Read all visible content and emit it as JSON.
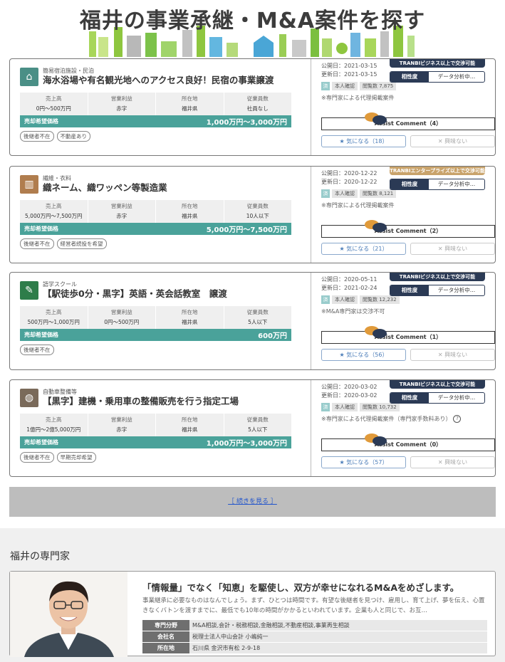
{
  "page_title": "福井の事業承継・M&A案件を探す",
  "listings": [
    {
      "category": "簡易宿泊施設・民泊",
      "category_icon": "building-icon",
      "icon_color": "#4a8f86",
      "title": "海水浴場や有名観光地へのアクセス良好！民宿の事業譲渡",
      "stats": [
        {
          "label": "売上高",
          "value": "0円〜500万円"
        },
        {
          "label": "営業利益",
          "value": "赤字"
        },
        {
          "label": "所在地",
          "value": "福井県"
        },
        {
          "label": "従業員数",
          "value": "社員なし"
        }
      ],
      "price_label": "売却希望価格",
      "price": "1,000万円〜3,000万円",
      "tags": [
        "後継者不在",
        "不動産あり"
      ],
      "published": "公開日：2021-03-15",
      "updated": "更新日：2021-03-15",
      "badge": "TRANBIビジネス以上で交渉可能",
      "badge_gold": false,
      "match_label": "相性度",
      "match_value": "データ分析中…",
      "proc_mark": "済",
      "proc_verified": "本人確認",
      "views": "閲覧数 7,875",
      "note": "※専門家による代理掲載案件",
      "note_help": false,
      "assist": "Assist Comment（4）",
      "fav": "★ 気になる（18）",
      "dislike": "✕ 興味ない"
    },
    {
      "category": "繊維・衣料",
      "category_icon": "factory-icon",
      "icon_color": "#b07d4e",
      "title": "織ネーム、織ワッペン等製造業",
      "stats": [
        {
          "label": "売上高",
          "value": "5,000万円〜7,500万円"
        },
        {
          "label": "営業利益",
          "value": "赤字"
        },
        {
          "label": "所在地",
          "value": "福井県"
        },
        {
          "label": "従業員数",
          "value": "10人以下"
        }
      ],
      "price_label": "売却希望価格",
      "price": "5,000万円〜7,500万円",
      "tags": [
        "後継者不在",
        "経営者続投を希望"
      ],
      "published": "公開日：2020-12-22",
      "updated": "更新日：2020-12-22",
      "badge": "TRANBIエンタープライズ以上で交渉可能",
      "badge_gold": true,
      "match_label": "相性度",
      "match_value": "データ分析中…",
      "proc_mark": "済",
      "proc_verified": "本人確認",
      "views": "閲覧数 8,121",
      "note": "※専門家による代理掲載案件",
      "note_help": false,
      "assist": "Assist Comment（2）",
      "fav": "★ 気になる（21）",
      "dislike": "✕ 興味ない"
    },
    {
      "category": "語学スクール",
      "category_icon": "pencil-icon",
      "icon_color": "#2e7d4a",
      "title": "【駅徒歩0分・黒字】英語・英会話教室　譲渡",
      "stats": [
        {
          "label": "売上高",
          "value": "500万円〜1,000万円"
        },
        {
          "label": "営業利益",
          "value": "0円〜500万円"
        },
        {
          "label": "所在地",
          "value": "福井県"
        },
        {
          "label": "従業員数",
          "value": "5人以下"
        }
      ],
      "price_label": "売却希望価格",
      "price": "600万円",
      "tags": [
        "後継者不在"
      ],
      "published": "公開日：2020-05-11",
      "updated": "更新日：2021-02-24",
      "badge": "TRANBIビジネス以上で交渉可能",
      "badge_gold": false,
      "match_label": "相性度",
      "match_value": "データ分析中…",
      "proc_mark": "済",
      "proc_verified": "本人確認",
      "views": "閲覧数 12,232",
      "note": "※M&A専門家は交渉不可",
      "note_help": false,
      "assist": "Assist Comment（1）",
      "fav": "★ 気になる（56）",
      "dislike": "✕ 興味ない"
    },
    {
      "category": "自動車整備等",
      "category_icon": "globe-icon",
      "icon_color": "#7a6a5a",
      "title": "【黒字】建機・乗用車の整備販売を行う指定工場",
      "stats": [
        {
          "label": "売上高",
          "value": "1億円〜2億5,000万円"
        },
        {
          "label": "営業利益",
          "value": "赤字"
        },
        {
          "label": "所在地",
          "value": "福井県"
        },
        {
          "label": "従業員数",
          "value": "5人以下"
        }
      ],
      "price_label": "売却希望価格",
      "price": "1,000万円〜3,000万円",
      "tags": [
        "後継者不在",
        "早期売却希望"
      ],
      "published": "公開日：2020-03-02",
      "updated": "更新日：2020-03-02",
      "badge": "TRANBIビジネス以上で交渉可能",
      "badge_gold": false,
      "match_label": "相性度",
      "match_value": "データ分析中…",
      "proc_mark": "済",
      "proc_verified": "本人確認",
      "views": "閲覧数 10,732",
      "note": "※専門家による代理掲載案件（専門家手数料あり）",
      "note_help": true,
      "assist": "Assist Comment（0）",
      "fav": "★ 気になる（57）",
      "dislike": "✕ 興味ない"
    }
  ],
  "more_link": "［ 続きを見る ］",
  "experts": {
    "section_title": "福井の専門家",
    "headline": "「情報量」でなく「知恵」を駆使し、双方が幸せになれるM&Aをめざします。",
    "description": "事業継承に必要なものはなんでしょう。まず、ひとつは時間です。有望な後継者を見つけ、雇用し、育て上げ、夢を伝え、心置きなくバトンを渡すまでに、最低でも10年の時間がかかるといわれています。企業も人と同じで、お互…",
    "rows": [
      {
        "key": "専門分野",
        "value": "M&A相談,会計・税務相談,金融相談,不動産相談,事業再生相談"
      },
      {
        "key": "会社名",
        "value": "税理士法人中山会計 小嶋純一"
      },
      {
        "key": "所在地",
        "value": "石川県 金沢市有松 2-9-18"
      }
    ]
  }
}
